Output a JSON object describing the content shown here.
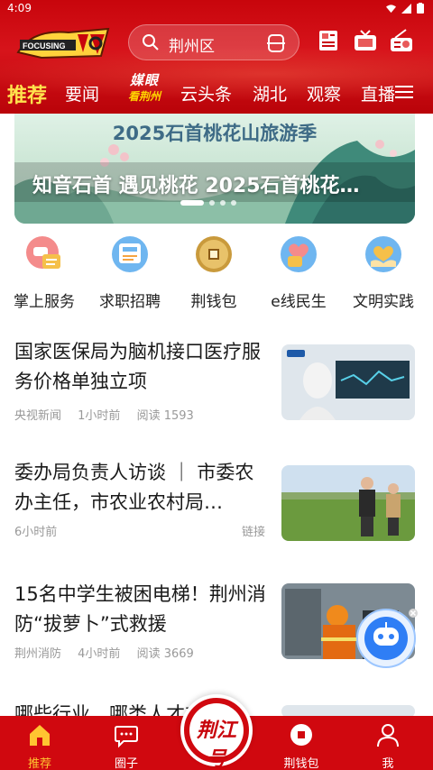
{
  "status": {
    "time": "4:09"
  },
  "header": {
    "logo_text": "FOCUSING",
    "search": {
      "text": "荆州区"
    },
    "icons": [
      "newspaper-icon",
      "tv-icon",
      "radio-icon"
    ]
  },
  "tabs": [
    {
      "label": "推荐",
      "active": true
    },
    {
      "label": "要闻"
    },
    {
      "label": "媒眼",
      "sub": "看荆州"
    },
    {
      "label": "云头条"
    },
    {
      "label": "湖北"
    },
    {
      "label": "观察"
    },
    {
      "label": "直播"
    }
  ],
  "banner": {
    "title": "2025石首桃花山旅游季",
    "caption": "知音石首  遇见桃花  2025石首桃花…",
    "slides_total": 4,
    "active_slide": 1
  },
  "services": [
    {
      "label": "掌上服务",
      "icon": "chat-service-icon"
    },
    {
      "label": "求职招聘",
      "icon": "job-board-icon"
    },
    {
      "label": "荆钱包",
      "icon": "coin-wallet-icon"
    },
    {
      "label": "e线民生",
      "icon": "thumbs-up-heart-icon"
    },
    {
      "label": "文明实践",
      "icon": "heart-hands-icon"
    }
  ],
  "news": [
    {
      "title": "国家医保局为脑机接口医疗服务价格单独立项",
      "source": "央视新闻",
      "time": "1小时前",
      "reads": "阅读 1593"
    },
    {
      "title": "委办局负责人访谈 ｜ 市委农办主任，市农业农村局…",
      "source": "",
      "time": "6小时前",
      "tag": "链接"
    },
    {
      "title": "15名中学生被困电梯！荆州消防“拔萝卜”式救援",
      "source": "荆州消防",
      "time": "4小时前",
      "reads": "阅读 3669"
    },
    {
      "title": "哪些行业、哪类人才在需求"
    }
  ],
  "bottom_nav": [
    {
      "label": "推荐",
      "icon": "home-icon",
      "active": true
    },
    {
      "label": "圈子",
      "icon": "chat-bubble-icon"
    },
    {
      "label": "荆江号",
      "icon": "center-logo-icon"
    },
    {
      "label": "荆钱包",
      "icon": "wallet-icon"
    },
    {
      "label": "我",
      "icon": "profile-icon"
    }
  ],
  "colors": {
    "brand_red": "#d0080f",
    "active_tab": "#ffe34d",
    "meta_gray": "#999999"
  }
}
